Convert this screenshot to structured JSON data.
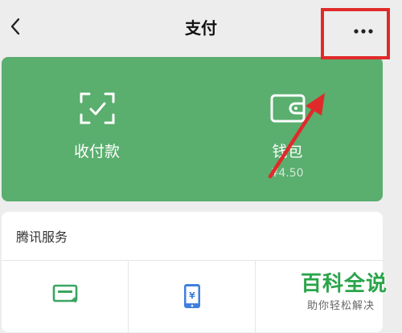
{
  "header": {
    "title": "支付",
    "back_icon": "chevron-left-icon",
    "more_icon": "more-dots-icon"
  },
  "pay_card": {
    "background": "#5aae6e",
    "items": [
      {
        "label": "收付款",
        "icon": "scan-qr-icon"
      },
      {
        "label": "钱包",
        "sub": "¥4.50",
        "icon": "wallet-icon"
      }
    ]
  },
  "services": {
    "title": "腾讯服务",
    "items": [
      {
        "icon": "card-icon"
      },
      {
        "icon": "phone-recharge-icon"
      },
      {
        "icon": "service-icon"
      }
    ]
  },
  "annotation": {
    "color": "#e02a2a"
  },
  "watermark": {
    "main": "百科全说",
    "sub": "助你轻松解决"
  }
}
